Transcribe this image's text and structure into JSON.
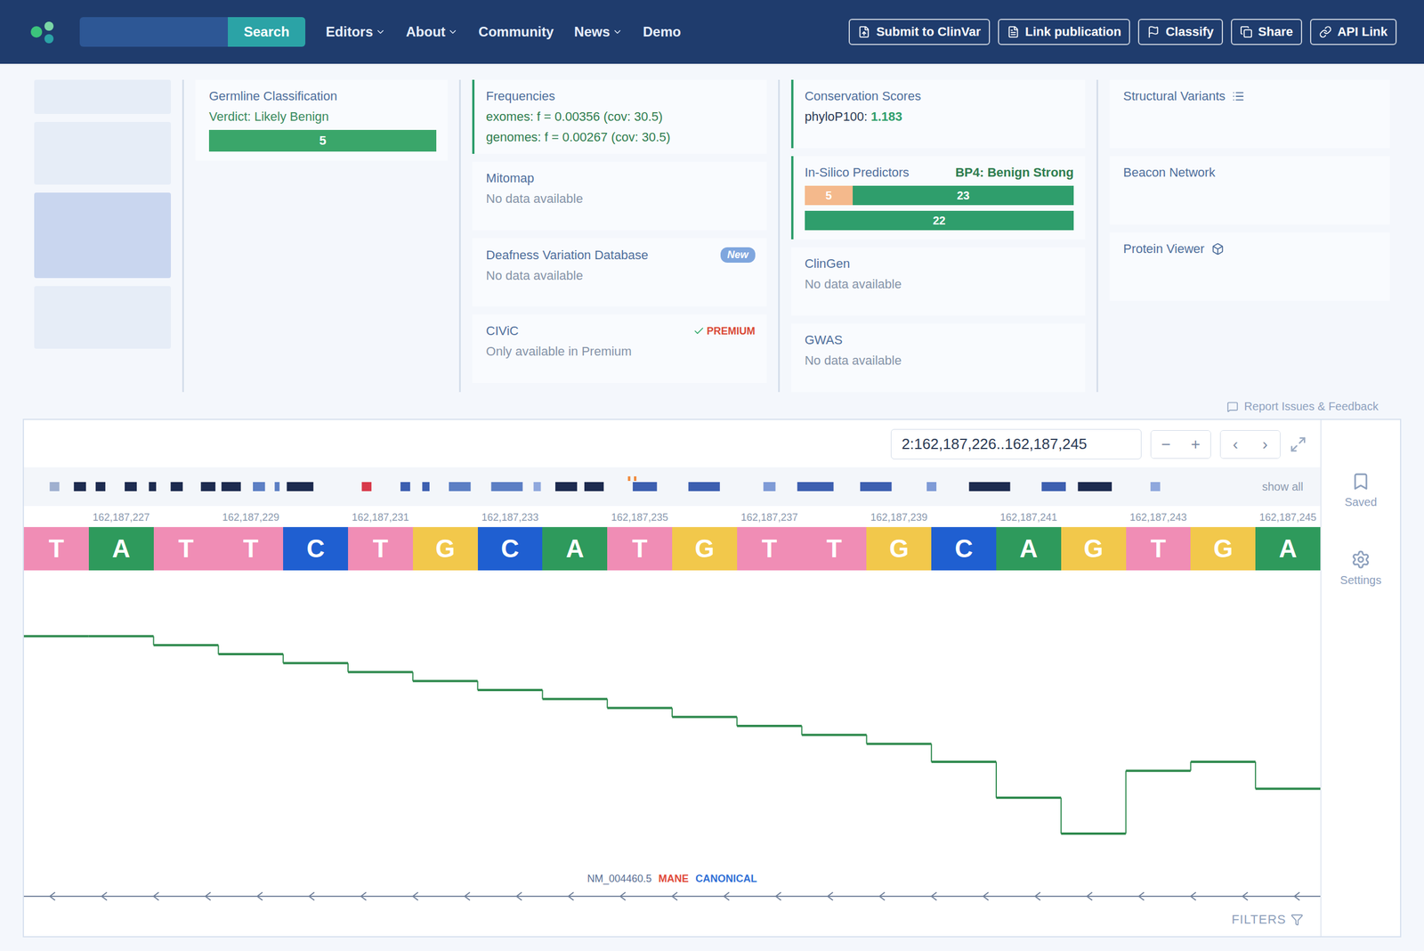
{
  "header": {
    "search_button": "Search",
    "nav": [
      {
        "label": "Editors",
        "dropdown": true
      },
      {
        "label": "About",
        "dropdown": true
      },
      {
        "label": "Community",
        "dropdown": false
      },
      {
        "label": "News",
        "dropdown": true
      },
      {
        "label": "Demo",
        "dropdown": false
      }
    ],
    "actions": [
      "Submit to ClinVar",
      "Link publication",
      "Classify",
      "Share",
      "API Link"
    ]
  },
  "classification": {
    "title": "Germline Classification",
    "verdict": "Verdict: Likely Benign",
    "score": "5"
  },
  "frequencies": {
    "title": "Frequencies",
    "lines": [
      "exomes: f = 0.00356 (cov: 30.5)",
      "genomes: f = 0.00267 (cov: 30.5)"
    ]
  },
  "databases": [
    {
      "title": "Mitomap",
      "note": "No data available"
    },
    {
      "title": "Deafness Variation Database",
      "note": "No data available",
      "badge": "New"
    },
    {
      "title": "CIViC",
      "note": "Only available in Premium",
      "badge": "PREMIUM"
    }
  ],
  "conservation": {
    "title": "Conservation Scores",
    "label": "phyloP100:",
    "value": "1.183"
  },
  "in_silico": {
    "title": "In-Silico Predictors",
    "verdict": "BP4: Benign Strong",
    "bars": [
      [
        {
          "value": "5",
          "color": "#f4b98c"
        },
        {
          "value": "23",
          "color": "#2f9e6c"
        }
      ],
      [
        {
          "value": "22",
          "color": "#2f9e6c"
        }
      ]
    ]
  },
  "side_cards": [
    {
      "title": "ClinGen",
      "note": "No data available"
    },
    {
      "title": "GWAS",
      "note": "No data available"
    }
  ],
  "right_cards": [
    {
      "title": "Structural Variants"
    },
    {
      "title": "Beacon Network"
    },
    {
      "title": "Protein Viewer"
    }
  ],
  "feedback": "Report Issues & Feedback",
  "browser": {
    "location": "2:162,187,226..162,187,245",
    "zoom_out": "−",
    "zoom_in": "+",
    "prev": "‹",
    "next": "›",
    "show_all": "show all",
    "ticks": [
      "162,187,227",
      "162,187,229",
      "162,187,231",
      "162,187,233",
      "162,187,235",
      "162,187,237",
      "162,187,239",
      "162,187,241",
      "162,187,243",
      "162,187,245"
    ],
    "sequence": [
      {
        "base": "T",
        "color": "#f08db5"
      },
      {
        "base": "A",
        "color": "#2e9a5c"
      },
      {
        "base": "T",
        "color": "#f08db5"
      },
      {
        "base": "T",
        "color": "#f08db5"
      },
      {
        "base": "C",
        "color": "#1f5fd1"
      },
      {
        "base": "T",
        "color": "#f08db5"
      },
      {
        "base": "G",
        "color": "#f2c84b"
      },
      {
        "base": "C",
        "color": "#1f5fd1"
      },
      {
        "base": "A",
        "color": "#2e9a5c"
      },
      {
        "base": "T",
        "color": "#f08db5"
      },
      {
        "base": "G",
        "color": "#f2c84b"
      },
      {
        "base": "T",
        "color": "#f08db5"
      },
      {
        "base": "T",
        "color": "#f08db5"
      },
      {
        "base": "G",
        "color": "#f2c84b"
      },
      {
        "base": "C",
        "color": "#1f5fd1"
      },
      {
        "base": "A",
        "color": "#2e9a5c"
      },
      {
        "base": "G",
        "color": "#f2c84b"
      },
      {
        "base": "T",
        "color": "#f08db5"
      },
      {
        "base": "G",
        "color": "#f2c84b"
      },
      {
        "base": "A",
        "color": "#2e9a5c"
      }
    ],
    "coverage": [
      30,
      30,
      29.5,
      29,
      28.5,
      28,
      27.5,
      27,
      26.5,
      26,
      25.5,
      25,
      24.5,
      24,
      23,
      21,
      19,
      22.5,
      23,
      21.5
    ],
    "transcript": {
      "id": "NM_004460.5",
      "tags": [
        {
          "label": "MANE",
          "color": "#e04a3a"
        },
        {
          "label": "CANONICAL",
          "color": "#2f6fd6"
        }
      ]
    },
    "filters": "FILTERS"
  },
  "side_tools": [
    {
      "label": "Saved"
    },
    {
      "label": "Settings"
    }
  ]
}
